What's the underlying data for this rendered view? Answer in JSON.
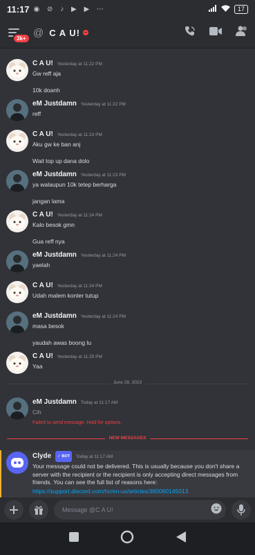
{
  "status_bar": {
    "time": "11:17",
    "notif_icons": [
      "whatsapp-icon",
      "muted-icon",
      "tiktok-icon",
      "play-icon",
      "play-icon",
      "more-icon"
    ],
    "battery": "17"
  },
  "header": {
    "badge": "3k+",
    "channel_name": "C A U!",
    "icons": [
      "call-icon",
      "video-icon",
      "members-icon"
    ]
  },
  "messages": [
    {
      "author": "C A U!",
      "avatar": "cau",
      "timestamp": "Yesterday at 11:22 PM",
      "lines": [
        "Gw reff aja",
        "",
        "10k doanh"
      ]
    },
    {
      "author": "eM Justdamn",
      "avatar": "em",
      "timestamp": "Yesterday at 11:22 PM",
      "lines": [
        "reff"
      ]
    },
    {
      "author": "C A U!",
      "avatar": "cau",
      "timestamp": "Yesterday at 11:23 PM",
      "lines": [
        "Aku gw ke ban anj",
        "",
        "Wait top up dana dolo"
      ]
    },
    {
      "author": "eM Justdamn",
      "avatar": "em",
      "timestamp": "Yesterday at 11:23 PM",
      "lines": [
        "ya walaupun 10k tetep berharga",
        "",
        "jangan lama"
      ]
    },
    {
      "author": "C A U!",
      "avatar": "cau",
      "timestamp": "Yesterday at 11:24 PM",
      "lines": [
        "Kalo besok gmn",
        "",
        "Gua reff nya"
      ]
    },
    {
      "author": "eM Justdamn",
      "avatar": "em",
      "timestamp": "Yesterday at 11:24 PM",
      "lines": [
        "yaelah"
      ]
    },
    {
      "author": "C A U!",
      "avatar": "cau",
      "timestamp": "Yesterday at 11:24 PM",
      "lines": [
        "Udah malem konter tutup"
      ]
    },
    {
      "author": "eM Justdamn",
      "avatar": "em",
      "timestamp": "Yesterday at 11:24 PM",
      "lines": [
        "masa besok",
        "",
        "yaudah awas boong lu"
      ]
    },
    {
      "author": "C A U!",
      "avatar": "cau",
      "timestamp": "Yesterday at 11:25 PM",
      "lines": [
        "Yaa"
      ]
    }
  ],
  "day_divider": "June 28, 2023",
  "today_message": {
    "author": "eM Justdamn",
    "timestamp": "Today at 11:17 AM",
    "text": "Cih",
    "error": "Failed to send message. Hold for options."
  },
  "new_messages_label": "NEW MESSAGES",
  "clyde": {
    "author": "Clyde",
    "tag": "✓ BOT",
    "timestamp": "Today at 11:17 AM",
    "text": "Your message could not be delivered. This is usually because you don't share a server with the recipient or the recipient is only accepting direct messages from friends. You can see the full list of reasons here:",
    "link": "https://support.discord.com/hc/en-us/articles/360060145013"
  },
  "composer": {
    "placeholder": "Message @C A U!"
  }
}
